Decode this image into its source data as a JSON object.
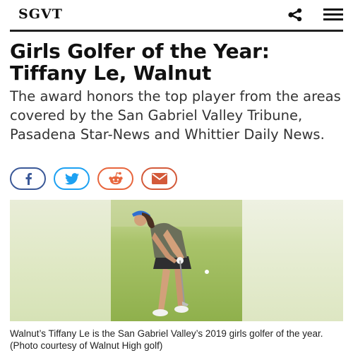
{
  "header": {
    "logo": "SGVT",
    "share_icon": "share-icon",
    "menu_icon": "hamburger-menu-icon"
  },
  "article": {
    "headline": "Girls Golfer of the Year: Tiffany Le, Walnut",
    "dek": "The award honors the top player from the areas covered by the San Gabriel Valley Tribune, Pasadena Star-News and Whittier Daily News.",
    "caption": "Walnut’s Tiffany Le is the San Gabriel Valley’s 2019 girls golfer of the year. (Photo courtesy of Walnut High golf)"
  },
  "share_buttons": [
    {
      "icon": "facebook-icon",
      "color": "#3b5998"
    },
    {
      "icon": "twitter-icon",
      "color": "#1da1f2"
    },
    {
      "icon": "reddit-icon",
      "color": "#e8663d"
    },
    {
      "icon": "email-icon",
      "color": "#d35a3a"
    }
  ],
  "colors": {
    "rule": "#222222",
    "text": "#111111"
  }
}
